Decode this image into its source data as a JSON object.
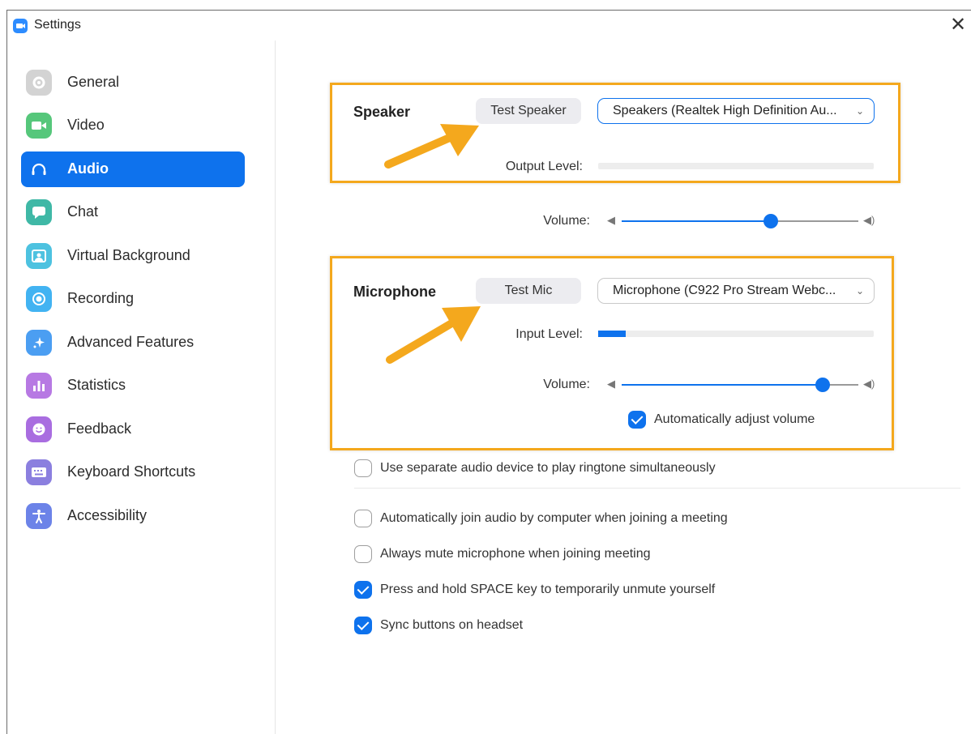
{
  "window": {
    "title": "Settings",
    "close_glyph": "✕"
  },
  "sidebar": {
    "items": [
      {
        "label": "General",
        "icon": "gear-icon",
        "active": false
      },
      {
        "label": "Video",
        "icon": "camera-icon",
        "active": false
      },
      {
        "label": "Audio",
        "icon": "headphones-icon",
        "active": true
      },
      {
        "label": "Chat",
        "icon": "chat-bubble-icon",
        "active": false
      },
      {
        "label": "Virtual Background",
        "icon": "person-frame-icon",
        "active": false
      },
      {
        "label": "Recording",
        "icon": "record-icon",
        "active": false
      },
      {
        "label": "Advanced Features",
        "icon": "sparkle-icon",
        "active": false
      },
      {
        "label": "Statistics",
        "icon": "bar-chart-icon",
        "active": false
      },
      {
        "label": "Feedback",
        "icon": "smiley-icon",
        "active": false
      },
      {
        "label": "Keyboard Shortcuts",
        "icon": "keyboard-icon",
        "active": false
      },
      {
        "label": "Accessibility",
        "icon": "accessibility-icon",
        "active": false
      }
    ]
  },
  "speaker": {
    "title": "Speaker",
    "test_label": "Test Speaker",
    "device": "Speakers (Realtek High Definition Au...",
    "output_level_label": "Output Level:",
    "output_level": 0,
    "volume_label": "Volume:",
    "volume": 0.63
  },
  "microphone": {
    "title": "Microphone",
    "test_label": "Test Mic",
    "device": "Microphone (C922 Pro Stream Webc...",
    "input_level_label": "Input Level:",
    "input_level": 0.1,
    "volume_label": "Volume:",
    "volume": 0.85,
    "auto_adjust_label": "Automatically adjust volume",
    "auto_adjust": true
  },
  "options": [
    {
      "label": "Use separate audio device to play ringtone simultaneously",
      "checked": false
    },
    {
      "label": "Automatically join audio by computer when joining a meeting",
      "checked": false
    },
    {
      "label": "Always mute microphone when joining meeting",
      "checked": false
    },
    {
      "label": "Press and hold SPACE key to temporarily unmute yourself",
      "checked": true
    },
    {
      "label": "Sync buttons on headset",
      "checked": true
    }
  ],
  "colors": {
    "accent": "#0e72ed",
    "highlight": "#f4a81d"
  }
}
